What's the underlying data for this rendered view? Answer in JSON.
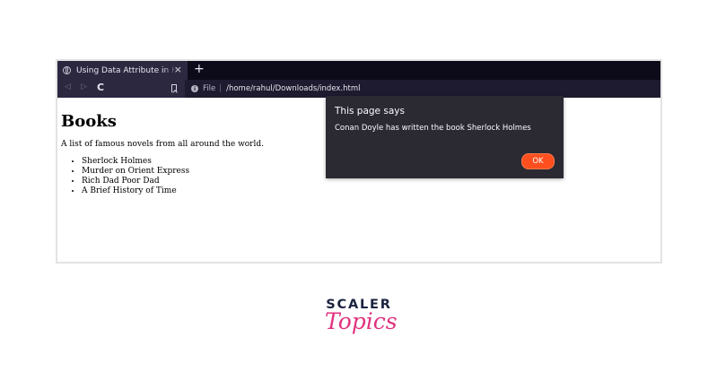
{
  "browser": {
    "tab_title": "Using Data Attribute in HT",
    "tab_close": "×",
    "new_tab": "+",
    "nav": {
      "back": "◁",
      "forward": "▷",
      "reload": "C"
    },
    "url_label": "File",
    "url_separator": "|",
    "url": "/home/rahul/Downloads/index.html",
    "info_glyph": "i"
  },
  "page": {
    "heading": "Books",
    "description": "A list of famous novels from all around the world.",
    "books": [
      "Sherlock Holmes",
      "Murder on Orient Express",
      "Rich Dad Poor Dad",
      "A Brief History of Time"
    ]
  },
  "dialog": {
    "title": "This page says",
    "message": "Conan Doyle has written the book Sherlock Holmes",
    "ok_label": "OK"
  },
  "logo": {
    "line1": "SCALER",
    "line2": "Topics"
  },
  "colors": {
    "tabbar": "#0d0a1a",
    "toolbar": "#2b2840",
    "dialog_bg": "#2b2a33",
    "ok_button": "#ff4f1f",
    "logo_dark": "#1b2340",
    "logo_pink": "#e0337f"
  }
}
